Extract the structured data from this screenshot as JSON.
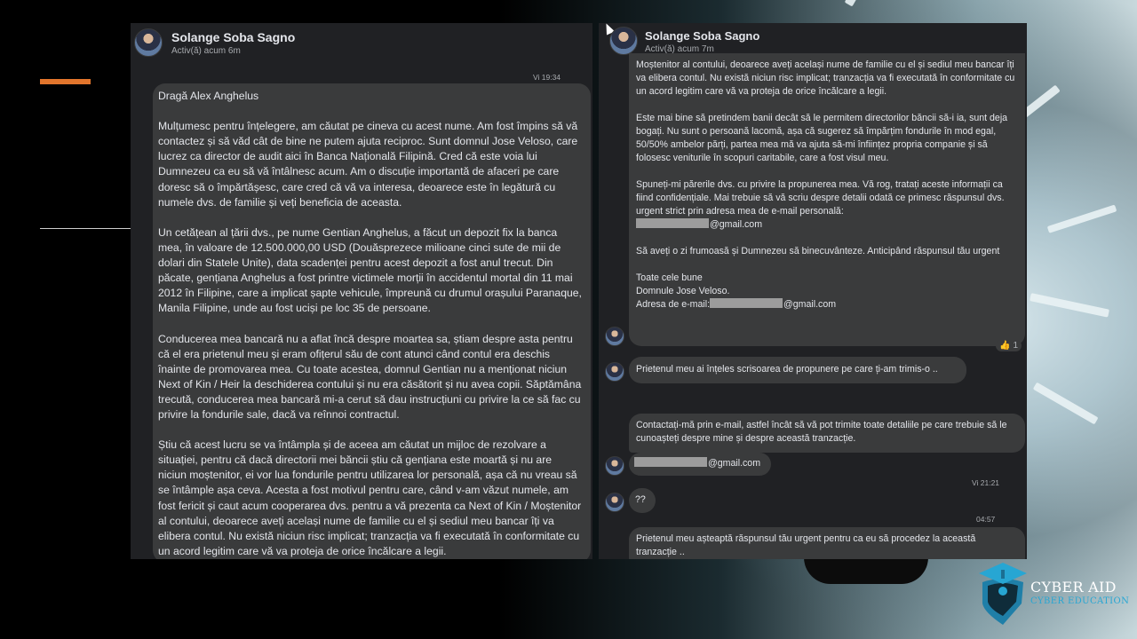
{
  "slide": {
    "accent_color": "#e2752c",
    "logo": {
      "title": "CYBER AID",
      "subtitle": "CYBER EDUCATION",
      "icon": "graduation-cap-shield-icon",
      "color": "#27a6d3"
    }
  },
  "left_panel": {
    "contact_name": "Solange Soba Sagno",
    "status": "Activ(ă) acum 6m",
    "timestamp": "Vi 19:34",
    "message": {
      "paragraphs": [
        "Dragă Alex Anghelus",
        "Mulțumesc pentru înțelegere, am căutat pe cineva cu acest nume. Am fost împins să vă contactez și să văd cât de bine ne putem ajuta reciproc. Sunt domnul Jose Veloso, care lucrez ca director de audit aici în Banca Națională Filipină. Cred că este voia lui Dumnezeu ca eu să vă întâlnesc acum. Am o discuție importantă de afaceri pe care doresc să o împărtășesc, care cred că vă va interesa, deoarece este în legătură cu numele dvs. de familie și veți beneficia de aceasta.",
        "Un cetățean al țării dvs., pe nume Gentian Anghelus, a făcut un depozit fix la banca mea, în valoare de 12.500.000,00 USD (Douăsprezece milioane cinci sute de mii de dolari din Statele Unite), data scadenței pentru acest depozit a fost anul trecut. Din păcate, gențiana Anghelus a fost printre victimele morții în accidentul mortal din 11 mai 2012 în Filipine, care a implicat șapte vehicule, împreună cu drumul orașului Paranaque, Manila Filipine, unde au fost uciși pe loc 35 de persoane.",
        "Conducerea mea bancară nu a aflat încă despre moartea sa, știam despre asta pentru că el era prietenul meu și eram ofițerul său de cont atunci când contul era deschis înainte de promovarea mea. Cu toate acestea, domnul Gentian nu a menționat niciun Next of Kin / Heir la deschiderea contului și nu era căsătorit și nu avea copii. Săptămâna trecută, conducerea mea bancară mi-a cerut să dau instrucțiuni cu privire la ce să fac cu privire la fondurile sale, dacă va reînnoi contractul.",
        "Știu că acest lucru se va întâmpla și de aceea am căutat un mijloc de rezolvare a situației, pentru că dacă directorii mei băncii știu că gențiana este moartă și nu are niciun moștenitor, ei vor lua fondurile pentru utilizarea lor personală, așa că nu vreau să se întâmple așa ceva. Acesta a fost motivul pentru care, când v-am văzut numele, am fost fericit și caut acum cooperarea dvs. pentru a vă prezenta ca Next of Kin / Moștenitor al contului, deoarece aveți același nume de familie cu el și sediul meu bancar îți va elibera contul. Nu există niciun risc implicat; tranzacția va fi executată în conformitate cu un acord legitim care vă va proteja de orice încălcare a legii."
      ]
    }
  },
  "right_panel": {
    "contact_name": "Solange Soba Sagno",
    "status": "Activ(ă) acum 7m",
    "long_message": {
      "p1": "Moștenitor al contului, deoarece aveți același nume de familie cu el și sediul meu bancar îți va elibera contul. Nu există niciun risc implicat; tranzacția va fi executată în conformitate cu un acord legitim care vă va proteja de orice încălcare a legii.",
      "p2": "Este mai bine să pretindem banii decât să le permitem directorilor băncii să-i ia, sunt deja bogați. Nu sunt o persoană lacomă, așa că sugerez să împărțim fondurile în mod egal, 50/50% ambelor părți, partea mea mă va ajuta să-mi înființez propria companie și să folosesc veniturile în scopuri caritabile, care a fost visul meu.",
      "p3": "Spuneți-mi părerile dvs. cu privire la propunerea mea. Vă rog, tratați aceste informații ca fiind confidențiale. Mai trebuie să vă scriu despre detalii odată ce primesc răspunsul dvs. urgent strict prin adresa mea de e-mail personală:",
      "email_suffix": "@gmail.com",
      "p4": "Să aveți o zi frumoasă și Dumnezeu să binecuvânteze. Anticipând răspunsul tău urgent",
      "sign_1": "Toate cele bune",
      "sign_2": "Domnule Jose Veloso.",
      "email_label": "Adresa de e-mail:",
      "reaction_emoji": "👍",
      "reaction_count": "1"
    },
    "msg_2": "Prietenul meu ai înțeles scrisoarea de propunere pe care ți-am trimis-o ..",
    "msg_3": "Contactați-mă prin e-mail, astfel încât să vă pot trimite toate detaliile pe care trebuie să le cunoașteți despre mine și despre această tranzacție.",
    "msg_4_suffix": "@gmail.com",
    "timestamp_1": "Vi 21:21",
    "msg_5": "??",
    "timestamp_2": "04:57",
    "msg_6": "Prietenul meu așteaptă răspunsul tău urgent pentru ca eu să procedez la această tranzacție .."
  }
}
